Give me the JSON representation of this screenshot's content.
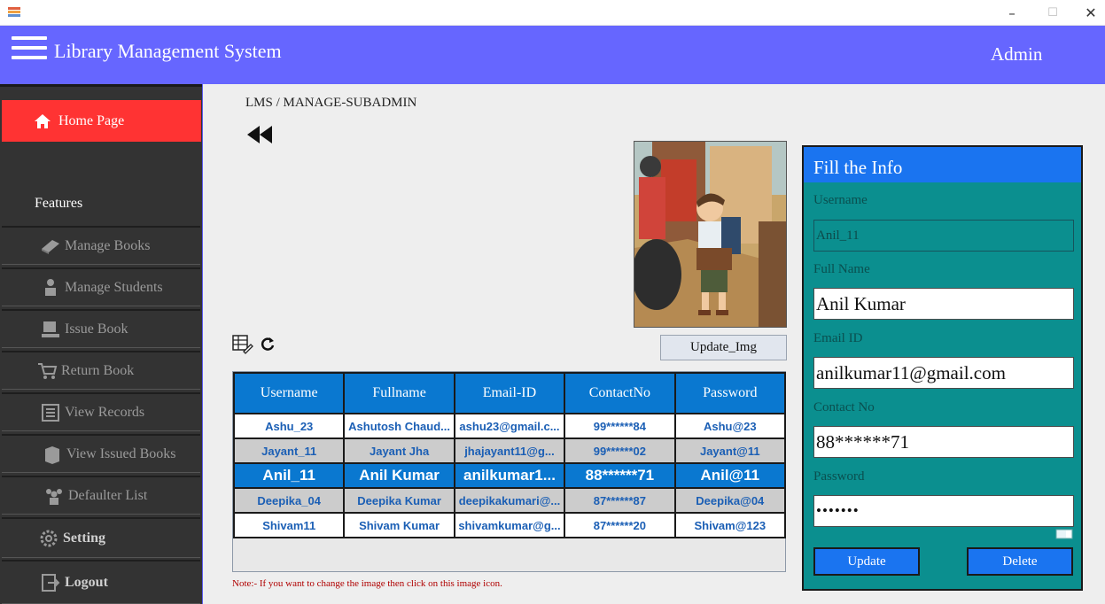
{
  "window": {
    "minimize": "–",
    "maximize": "☐",
    "close": "✕"
  },
  "header": {
    "title": "Library Management System",
    "user": "Admin"
  },
  "sidebar": {
    "home": "Home Page",
    "features_heading": "Features",
    "items": [
      {
        "label": "Manage Books",
        "icon": "book-icon"
      },
      {
        "label": "Manage Students",
        "icon": "student-icon"
      },
      {
        "label": "Issue Book",
        "icon": "issue-icon"
      },
      {
        "label": "Return Book",
        "icon": "return-icon"
      },
      {
        "label": "View Records",
        "icon": "records-icon"
      },
      {
        "label": "View Issued Books",
        "icon": "issued-books-icon"
      },
      {
        "label": "Defaulter List",
        "icon": "group-icon"
      },
      {
        "label": "Setting",
        "icon": "gear-icon"
      },
      {
        "label": "Logout",
        "icon": "logout-icon"
      }
    ]
  },
  "breadcrumb": "LMS / MANAGE-SUBADMIN",
  "update_img_label": "Update_Img",
  "table": {
    "columns": [
      "Username",
      "Fullname",
      "Email-ID",
      "ContactNo",
      "Password"
    ],
    "rows": [
      [
        "Ashu_23",
        "Ashutosh Chaud...",
        "ashu23@gmail.c...",
        "99******84",
        "Ashu@23"
      ],
      [
        "Jayant_11",
        "Jayant Jha",
        "jhajayant11@g...",
        "99******02",
        "Jayant@11"
      ],
      [
        "Anil_11",
        "Anil Kumar",
        "anilkumar1...",
        "88******71",
        "Anil@11"
      ],
      [
        "Deepika_04",
        "Deepika Kumar",
        "deepikakumari@...",
        "87******87",
        "Deepika@04"
      ],
      [
        "Shivam11",
        "Shivam Kumar",
        "shivamkumar@g...",
        "87******20",
        "Shivam@123"
      ]
    ],
    "selected_row": 2
  },
  "note": "Note:- If you want to change the image then click on this image icon.",
  "form": {
    "heading": "Fill the Info",
    "username_label": "Username",
    "username_value": "Anil_11",
    "fullname_label": "Full Name",
    "fullname_value": "Anil Kumar",
    "email_label": "Email ID",
    "email_value": "anilkumar11@gmail.com",
    "contact_label": "Contact No",
    "contact_value": "88******71",
    "password_label": "Password",
    "password_value": "•••••••",
    "update_label": "Update",
    "delete_label": "Delete"
  },
  "colors": {
    "header": "#6666ff",
    "sidebar": "#333333",
    "home_active": "#ff3333",
    "table_header": "#0a78d0",
    "form_bg": "#0b8f8f",
    "form_button": "#1a74f0"
  }
}
